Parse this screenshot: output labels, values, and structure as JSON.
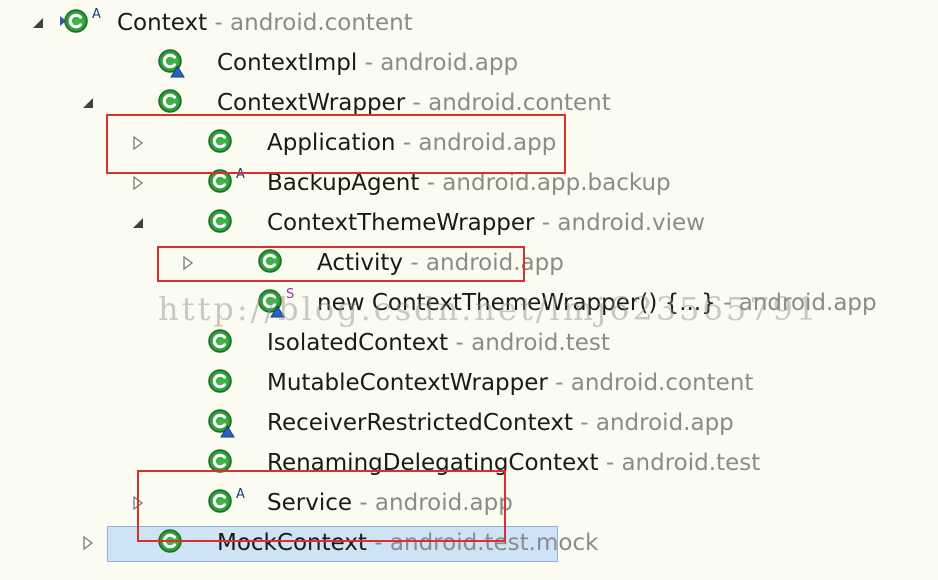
{
  "tree": {
    "rows": [
      {
        "class_name": "Context",
        "package": " - android.content",
        "expander": "expanded",
        "icon": "class-icon",
        "icon_overlay": "A",
        "overlay_type": "abstract"
      },
      {
        "class_name": "ContextImpl",
        "package": " - android.app",
        "expander": "none",
        "icon": "class-icon",
        "icon_overlay": "",
        "overlay_type": "package-private"
      },
      {
        "class_name": "ContextWrapper",
        "package": " - android.content",
        "expander": "expanded",
        "icon": "class-icon",
        "icon_overlay": "",
        "overlay_type": "none"
      },
      {
        "class_name": "Application",
        "package": " - android.app",
        "expander": "collapsed",
        "icon": "class-icon",
        "icon_overlay": "",
        "overlay_type": "none"
      },
      {
        "class_name": "BackupAgent",
        "package": " - android.app.backup",
        "expander": "collapsed",
        "icon": "class-icon",
        "icon_overlay": "A",
        "overlay_type": "abstract"
      },
      {
        "class_name": "ContextThemeWrapper",
        "package": " - android.view",
        "expander": "expanded",
        "icon": "class-icon",
        "icon_overlay": "",
        "overlay_type": "none"
      },
      {
        "class_name": "Activity",
        "package": " - android.app",
        "expander": "collapsed",
        "icon": "class-icon",
        "icon_overlay": "",
        "overlay_type": "none"
      },
      {
        "class_name": "new ContextThemeWrapper() {...}",
        "package": " - android.app",
        "expander": "none",
        "icon": "class-icon",
        "icon_overlay": "S",
        "overlay_type": "static-package-private"
      },
      {
        "class_name": "IsolatedContext",
        "package": " - android.test",
        "expander": "none",
        "icon": "class-icon",
        "icon_overlay": "",
        "overlay_type": "none"
      },
      {
        "class_name": "MutableContextWrapper",
        "package": " - android.content",
        "expander": "none",
        "icon": "class-icon",
        "icon_overlay": "",
        "overlay_type": "none"
      },
      {
        "class_name": "ReceiverRestrictedContext",
        "package": " - android.app",
        "expander": "none",
        "icon": "class-icon",
        "icon_overlay": "",
        "overlay_type": "package-private"
      },
      {
        "class_name": "RenamingDelegatingContext",
        "package": " - android.test",
        "expander": "none",
        "icon": "class-icon",
        "icon_overlay": "",
        "overlay_type": "none"
      },
      {
        "class_name": "Service",
        "package": " - android.app",
        "expander": "collapsed",
        "icon": "class-icon",
        "icon_overlay": "A",
        "overlay_type": "abstract"
      },
      {
        "class_name": "MockContext",
        "package": " - android.test.mock",
        "expander": "collapsed",
        "icon": "class-icon",
        "icon_overlay": "",
        "overlay_type": "none",
        "selected": true
      }
    ]
  },
  "watermark": "http://blog.csdn.net/lmj623565791",
  "colors": {
    "background": "#fbfbf1",
    "class_icon_green": "#2f9a3a",
    "highlight_box": "#d8302c",
    "selection": "#cfe3f6",
    "package_text": "#8b8b8b"
  },
  "highlighted_rows": [
    "Application",
    "Activity",
    "Service"
  ]
}
